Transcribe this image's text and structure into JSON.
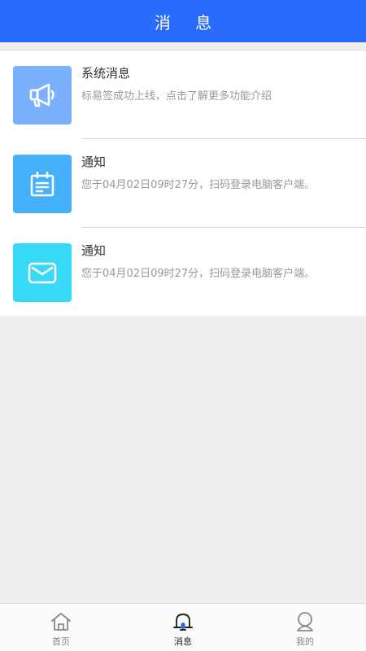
{
  "header": {
    "title": "消 息"
  },
  "messages": [
    {
      "title": "系统消息",
      "desc": "标易签成功上线，点击了解更多功能介绍",
      "icon": "megaphone-icon",
      "color": "#7bb0ff"
    },
    {
      "title": "通知",
      "desc": "您于04月02日09时27分，扫码登录电脑客户端。",
      "icon": "calendar-notice-icon",
      "color": "#45b0fb"
    },
    {
      "title": "通知",
      "desc": "您于04月02日09时27分，扫码登录电脑客户端。",
      "icon": "mail-icon",
      "color": "#38d9f7"
    }
  ],
  "tabbar": {
    "items": [
      {
        "label": "首页",
        "icon": "home-icon",
        "active": false
      },
      {
        "label": "消息",
        "icon": "bell-icon",
        "active": true
      },
      {
        "label": "我的",
        "icon": "profile-icon",
        "active": false
      }
    ]
  },
  "colors": {
    "primary": "#2a6bfc",
    "active_tab_dot": "#2a6bfc"
  }
}
